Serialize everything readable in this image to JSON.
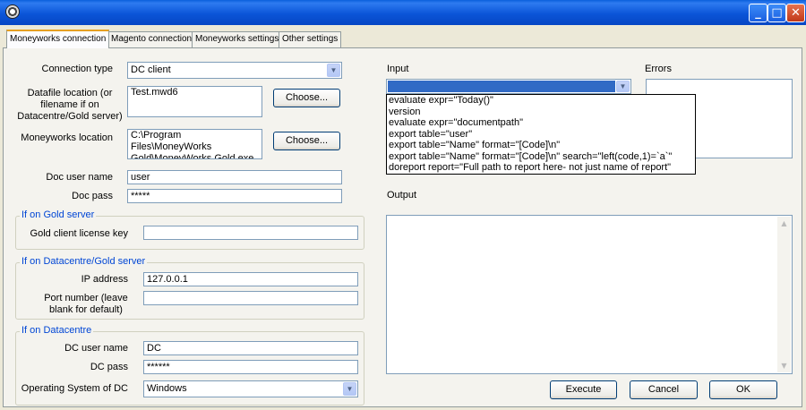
{
  "window": {
    "minimize_glyph": "_",
    "maximize_glyph": "□",
    "close_glyph": "✕"
  },
  "tabs": [
    {
      "label": "Moneyworks connection"
    },
    {
      "label": "Magento connection"
    },
    {
      "label": "Moneyworks settings"
    },
    {
      "label": "Other settings"
    }
  ],
  "connection": {
    "type_label": "Connection type",
    "type_value": "DC client",
    "datafile_label": "Datafile location (or filename if on Datacentre/Gold server)",
    "datafile_value": "Test.mwd6",
    "datafile_choose": "Choose...",
    "mw_location_label": "Moneyworks location",
    "mw_location_value": "C:\\Program Files\\MoneyWorks Gold\\MoneyWorks Gold.exe",
    "mw_location_choose": "Choose...",
    "doc_user_label": "Doc user name",
    "doc_user_value": "user",
    "doc_pass_label": "Doc pass",
    "doc_pass_value": "*****"
  },
  "gold_group": {
    "title": "If on Gold server",
    "license_label": "Gold client license key",
    "license_value": ""
  },
  "dc_gold_group": {
    "title": "If on Datacentre/Gold server",
    "ip_label": "IP address",
    "ip_value": "127.0.0.1",
    "port_label": "Port number (leave blank for default)",
    "port_value": ""
  },
  "dc_group": {
    "title": "If on Datacentre",
    "user_label": "DC user name",
    "user_value": "DC",
    "pass_label": "DC pass",
    "pass_value": "******",
    "os_label": "Operating System of DC",
    "os_value": "Windows"
  },
  "right": {
    "input_label": "Input",
    "input_value": "",
    "errors_label": "Errors",
    "output_label": "Output",
    "input_options": [
      "evaluate expr=\"Today()\"",
      "version",
      "evaluate expr=\"documentpath\"",
      "export table=\"user\"",
      "export table=\"Name\" format=\"[Code]\\n\"",
      "export table=\"Name\" format=\"[Code]\\n\" search=\"left(code,1)=`a`\"",
      "doreport report=\"Full path to report here- not just name of report\""
    ]
  },
  "buttons": {
    "execute": "Execute",
    "cancel": "Cancel",
    "ok": "OK"
  },
  "icons": {
    "app": "app-gear-icon",
    "dropdown": "chevron-down-icon",
    "scroll_up": "arrow-up-icon",
    "scroll_down": "arrow-down-icon"
  }
}
